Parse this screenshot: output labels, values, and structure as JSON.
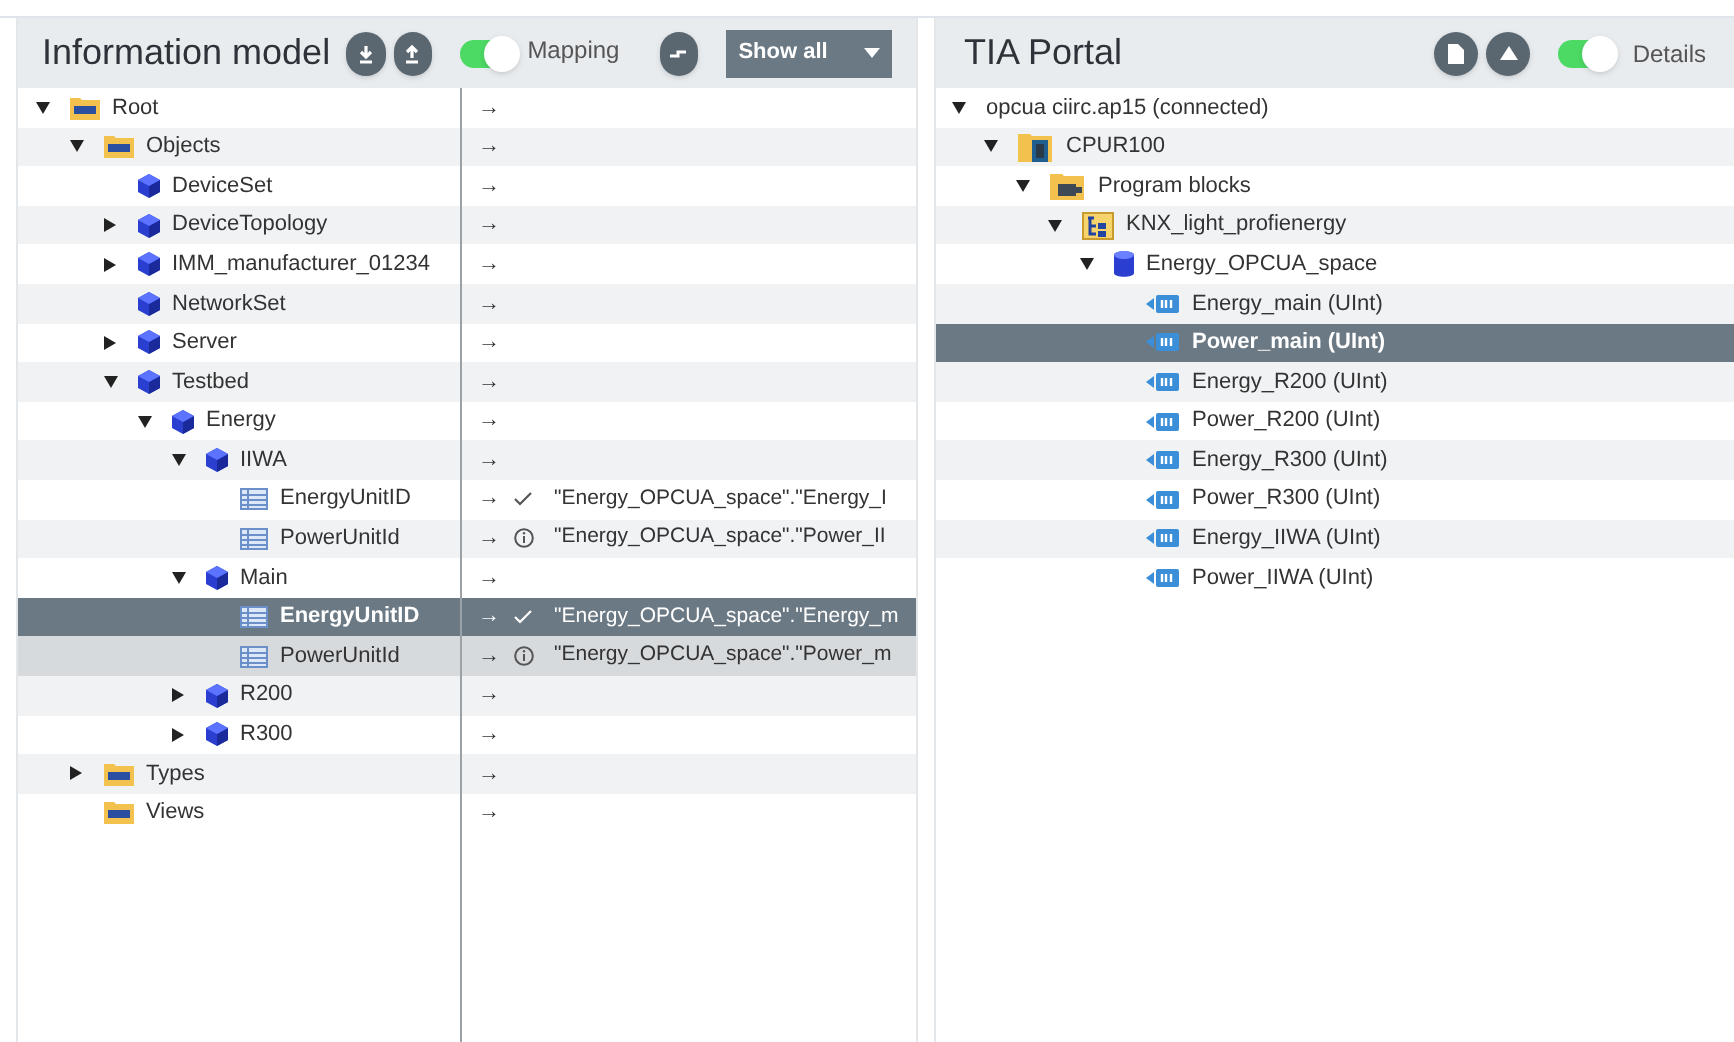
{
  "left_panel": {
    "title": "Information model",
    "toggle": {
      "label": "Mapping",
      "on": true
    },
    "filter": {
      "value": "Show all"
    },
    "tree": [
      {
        "label": "Root",
        "kind": "opc",
        "expanded": true,
        "selected": false,
        "marked": false,
        "arrow": "→",
        "children": [
          {
            "label": "Objects",
            "kind": "opc",
            "expanded": true,
            "selected": false,
            "marked": false,
            "arrow": "→",
            "children": [
              {
                "label": "DeviceSet",
                "kind": "object",
                "selected": false,
                "marked": false,
                "arrow": "→"
              },
              {
                "label": "DeviceTopology",
                "kind": "object",
                "expanded": false,
                "selected": false,
                "marked": false,
                "arrow": "→"
              },
              {
                "label": "IMM_manufacturer_01234",
                "kind": "object",
                "expanded": false,
                "selected": false,
                "marked": false,
                "arrow": "→"
              },
              {
                "label": "NetworkSet",
                "kind": "object",
                "selected": false,
                "marked": false,
                "arrow": "→"
              },
              {
                "label": "Server",
                "kind": "object",
                "expanded": false,
                "selected": false,
                "marked": false,
                "arrow": "→"
              },
              {
                "label": "Testbed",
                "kind": "object",
                "expanded": true,
                "selected": false,
                "marked": false,
                "arrow": "→",
                "children": [
                  {
                    "label": "Energy",
                    "kind": "object",
                    "expanded": true,
                    "selected": false,
                    "marked": false,
                    "arrow": "→",
                    "children": [
                      {
                        "label": "IIWA",
                        "kind": "object",
                        "expanded": true,
                        "selected": false,
                        "marked": false,
                        "arrow": "→",
                        "children": [
                          {
                            "label": "EnergyUnitID",
                            "kind": "variable",
                            "selected": false,
                            "marked": false,
                            "arrow": "→",
                            "mapping": {
                              "kind": "ok",
                              "target": "\"Energy_OPCUA_space\".\"Energy_I"
                            }
                          },
                          {
                            "label": "PowerUnitId",
                            "kind": "variable",
                            "selected": false,
                            "marked": false,
                            "arrow": "→",
                            "mapping": {
                              "kind": "info",
                              "target": "\"Energy_OPCUA_space\".\"Power_II"
                            }
                          }
                        ]
                      },
                      {
                        "label": "Main",
                        "kind": "object",
                        "expanded": true,
                        "selected": false,
                        "marked": false,
                        "arrow": "→",
                        "children": [
                          {
                            "label": "EnergyUnitID",
                            "kind": "variable",
                            "selected": true,
                            "marked": false,
                            "arrow": "→",
                            "mapping": {
                              "kind": "ok",
                              "target": "\"Energy_OPCUA_space\".\"Energy_m"
                            }
                          },
                          {
                            "label": "PowerUnitId",
                            "kind": "variable",
                            "selected": false,
                            "marked": true,
                            "arrow": "→",
                            "mapping": {
                              "kind": "info",
                              "target": "\"Energy_OPCUA_space\".\"Power_m"
                            }
                          }
                        ]
                      },
                      {
                        "label": "R200",
                        "kind": "object",
                        "expanded": false,
                        "selected": false,
                        "marked": false,
                        "arrow": "→"
                      },
                      {
                        "label": "R300",
                        "kind": "object",
                        "expanded": false,
                        "selected": false,
                        "marked": false,
                        "arrow": "→"
                      }
                    ]
                  }
                ]
              }
            ]
          },
          {
            "label": "Types",
            "kind": "opc",
            "expanded": false,
            "selected": false,
            "marked": false,
            "arrow": "→"
          },
          {
            "label": "Views",
            "kind": "opc",
            "selected": false,
            "marked": false,
            "arrow": "→"
          }
        ]
      }
    ]
  },
  "right_panel": {
    "title": "TIA Portal",
    "toggle": {
      "label": "Details",
      "on": true
    },
    "tree": [
      {
        "label": "opcua ciirc.ap15 (connected)",
        "expanded": true,
        "selected": false,
        "children": [
          {
            "label": "CPUR100",
            "kind": "cpu",
            "expanded": true,
            "selected": false,
            "children": [
              {
                "label": "Program blocks",
                "kind": "program_blocks",
                "expanded": true,
                "selected": false,
                "children": [
                  {
                    "label": "KNX_light_profienergy",
                    "kind": "block",
                    "expanded": true,
                    "selected": false,
                    "children": [
                      {
                        "label": "Energy_OPCUA_space",
                        "kind": "db",
                        "expanded": true,
                        "selected": false,
                        "children": [
                          {
                            "label": "Energy_main (UInt)",
                            "kind": "tag",
                            "selected": false
                          },
                          {
                            "label": "Power_main (UInt)",
                            "kind": "tag",
                            "selected": true
                          },
                          {
                            "label": "Energy_R200 (UInt)",
                            "kind": "tag",
                            "selected": false
                          },
                          {
                            "label": "Power_R200 (UInt)",
                            "kind": "tag",
                            "selected": false
                          },
                          {
                            "label": "Energy_R300 (UInt)",
                            "kind": "tag",
                            "selected": false
                          },
                          {
                            "label": "Power_R300 (UInt)",
                            "kind": "tag",
                            "selected": false
                          },
                          {
                            "label": "Energy_IIWA (UInt)",
                            "kind": "tag",
                            "selected": false
                          },
                          {
                            "label": "Power_IIWA (UInt)",
                            "kind": "tag",
                            "selected": false
                          }
                        ]
                      }
                    ]
                  }
                ]
              }
            ]
          }
        ]
      }
    ]
  }
}
